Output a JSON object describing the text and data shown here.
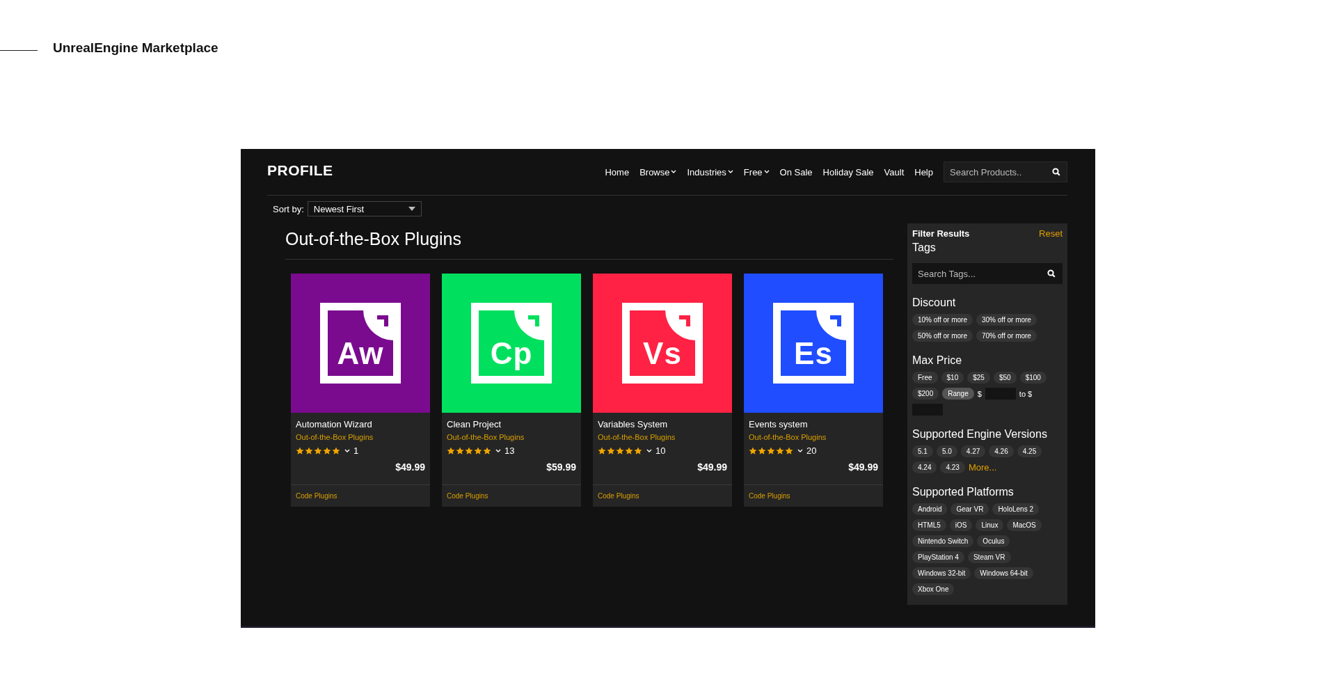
{
  "page_title": "UnrealEngine Marketplace",
  "header": {
    "logo": "PROFILE",
    "nav": [
      {
        "label": "Home",
        "dropdown": false
      },
      {
        "label": "Browse",
        "dropdown": true
      },
      {
        "label": "Industries",
        "dropdown": true
      },
      {
        "label": "Free",
        "dropdown": true
      },
      {
        "label": "On Sale",
        "dropdown": false
      },
      {
        "label": "Holiday Sale",
        "dropdown": false
      },
      {
        "label": "Vault",
        "dropdown": false
      },
      {
        "label": "Help",
        "dropdown": false
      }
    ],
    "search": {
      "placeholder": "Search Products.."
    }
  },
  "sort": {
    "label": "Sort by:",
    "value": "Newest First"
  },
  "category_title": "Out-of-the-Box Plugins",
  "products": [
    {
      "letters": "Aw",
      "color": "#7a0b8f",
      "name": "Automation Wizard",
      "category": "Out-of-the-Box Plugins",
      "stars": 5,
      "rating_count": "1",
      "price": "$49.99",
      "tag": "Code Plugins"
    },
    {
      "letters": "Cp",
      "color": "#00e05e",
      "name": "Clean Project",
      "category": "Out-of-the-Box Plugins",
      "stars": 5,
      "rating_count": "13",
      "price": "$59.99",
      "tag": "Code Plugins"
    },
    {
      "letters": "Vs",
      "color": "#ff2244",
      "name": "Variables System",
      "category": "Out-of-the-Box Plugins",
      "stars": 5,
      "rating_count": "10",
      "price": "$49.99",
      "tag": "Code Plugins"
    },
    {
      "letters": "Es",
      "color": "#1f4dff",
      "name": "Events system",
      "category": "Out-of-the-Box Plugins",
      "stars": 5,
      "rating_count": "20",
      "price": "$49.99",
      "tag": "Code Plugins"
    }
  ],
  "filters": {
    "title": "Filter Results",
    "reset": "Reset",
    "tags": {
      "title": "Tags",
      "placeholder": "Search Tags..."
    },
    "discount": {
      "title": "Discount",
      "chips": [
        {
          "label": "10% off or more",
          "selected": false
        },
        {
          "label": "30% off or more",
          "selected": false
        },
        {
          "label": "50% off or more",
          "selected": false
        },
        {
          "label": "70% off or more",
          "selected": false
        }
      ]
    },
    "max_price": {
      "title": "Max Price",
      "chips": [
        {
          "label": "Free",
          "selected": false
        },
        {
          "label": "$10",
          "selected": false
        },
        {
          "label": "$25",
          "selected": false
        },
        {
          "label": "$50",
          "selected": false
        },
        {
          "label": "$100",
          "selected": false
        },
        {
          "label": "$200",
          "selected": false
        }
      ],
      "range": {
        "label": "Range",
        "selected": true,
        "from_label": "$",
        "to_label": "to $"
      }
    },
    "engine_versions": {
      "title": "Supported Engine Versions",
      "chips": [
        {
          "label": "5.1",
          "selected": false
        },
        {
          "label": "5.0",
          "selected": false
        },
        {
          "label": "4.27",
          "selected": false
        },
        {
          "label": "4.26",
          "selected": false
        },
        {
          "label": "4.25",
          "selected": false
        },
        {
          "label": "4.24",
          "selected": false
        },
        {
          "label": "4.23",
          "selected": false
        }
      ],
      "more": "More..."
    },
    "platforms": {
      "title": "Supported Platforms",
      "chips": [
        {
          "label": "Android",
          "selected": false
        },
        {
          "label": "Gear VR",
          "selected": false
        },
        {
          "label": "HoloLens 2",
          "selected": false
        },
        {
          "label": "HTML5",
          "selected": false
        },
        {
          "label": "iOS",
          "selected": false
        },
        {
          "label": "Linux",
          "selected": false
        },
        {
          "label": "MacOS",
          "selected": false
        },
        {
          "label": "Nintendo Switch",
          "selected": false
        },
        {
          "label": "Oculus",
          "selected": false
        },
        {
          "label": "PlayStation 4",
          "selected": false
        },
        {
          "label": "Steam VR",
          "selected": false
        },
        {
          "label": "Windows 32-bit",
          "selected": false
        },
        {
          "label": "Windows 64-bit",
          "selected": false
        },
        {
          "label": "Xbox One",
          "selected": false
        }
      ]
    }
  }
}
